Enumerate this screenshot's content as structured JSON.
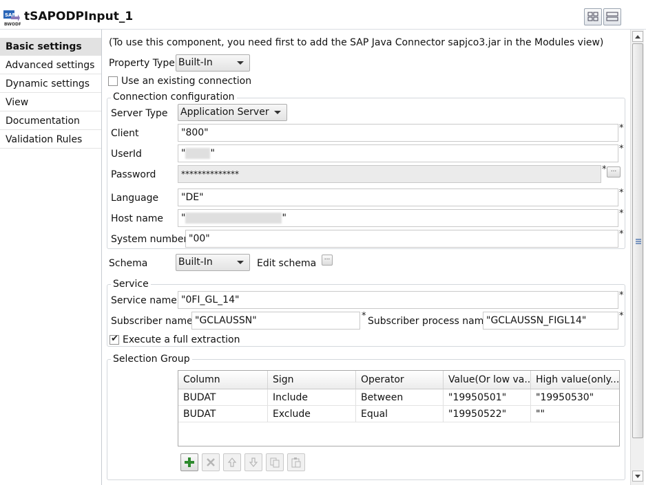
{
  "header": {
    "title": "tSAPODPInput_1",
    "app_icon": "sap-bw-odp-icon"
  },
  "sidebar": {
    "items": [
      {
        "label": "Basic settings",
        "active": true
      },
      {
        "label": "Advanced settings"
      },
      {
        "label": "Dynamic settings"
      },
      {
        "label": "View"
      },
      {
        "label": "Documentation"
      },
      {
        "label": "Validation Rules"
      }
    ]
  },
  "main": {
    "notice": "(To use this component, you need first to add the SAP Java Connector sapjco3.jar in the Modules view)",
    "property_type": {
      "label": "Property Type",
      "value": "Built-In"
    },
    "use_existing_connection": {
      "label": "Use an existing connection",
      "checked": false
    },
    "connection": {
      "title": "Connection configuration",
      "server_type": {
        "label": "Server Type",
        "value": "Application Server"
      },
      "client": {
        "label": "Client",
        "value": "\"800\""
      },
      "userid": {
        "label": "UserId",
        "value_prefix": "\"",
        "value_suffix": "\""
      },
      "password": {
        "label": "Password",
        "value": "**************"
      },
      "language": {
        "label": "Language",
        "value": "\"DE\""
      },
      "host_name": {
        "label": "Host name",
        "value_prefix": "\"",
        "value_suffix": "\""
      },
      "system_number": {
        "label": "System number",
        "value": "\"00\""
      },
      "required_mark": "*",
      "ellipsis": "..."
    },
    "schema": {
      "label": "Schema",
      "value": "Built-In",
      "edit_label": "Edit schema"
    },
    "service": {
      "title": "Service",
      "service_name": {
        "label": "Service name",
        "value": "\"0FI_GL_14\""
      },
      "subscriber_name": {
        "label": "Subscriber name",
        "value": "\"GCLAUSSN\""
      },
      "subscriber_process_name": {
        "label": "Subscriber process name",
        "value": "\"GCLAUSSN_FIGL14\""
      }
    },
    "full_extraction": {
      "label": "Execute a full extraction",
      "checked": true
    },
    "selection_group": {
      "title": "Selection Group",
      "columns": [
        "Column",
        "Sign",
        "Operator",
        "Value(Or low va...",
        "High value(only..."
      ],
      "rows": [
        [
          "BUDAT",
          "Include",
          "Between",
          "\"19950501\"",
          "\"19950530\""
        ],
        [
          "BUDAT",
          "Exclude",
          "Equal",
          "\"19950522\"",
          "\"\""
        ]
      ]
    },
    "table_toolbar": [
      "add-icon",
      "remove-icon",
      "move-up-icon",
      "move-down-icon",
      "copy-icon",
      "paste-icon"
    ]
  },
  "colors": {
    "active_tab_bg": "#e2e2e2",
    "add_green": "#2e8a2e"
  }
}
